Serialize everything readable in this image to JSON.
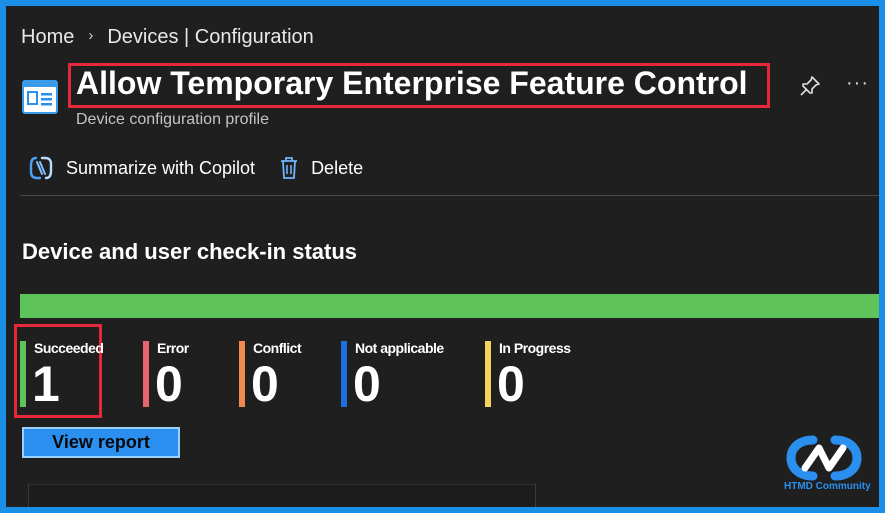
{
  "breadcrumb": {
    "home": "Home",
    "separator": "›",
    "current": "Devices | Configuration"
  },
  "header": {
    "title": "Allow Temporary Enterprise Feature Control",
    "subtitle": "Device configuration profile",
    "more_label": "···",
    "icons": [
      "profile-card-icon",
      "pin-icon",
      "more-icon"
    ]
  },
  "toolbar": {
    "copilot_label": "Summarize with Copilot",
    "delete_label": "Delete"
  },
  "section": {
    "title": "Device and user check-in status"
  },
  "status_bar": {
    "succeeded_fraction": 1.0,
    "color": "#5ec45a"
  },
  "statuses": [
    {
      "label": "Succeeded",
      "value": "1",
      "color": "#5ec45a"
    },
    {
      "label": "Error",
      "value": "0",
      "color": "#e8646e"
    },
    {
      "label": "Conflict",
      "value": "0",
      "color": "#f0894f"
    },
    {
      "label": "Not applicable",
      "value": "0",
      "color": "#1e6ee0"
    },
    {
      "label": "In Progress",
      "value": "0",
      "color": "#f4d35e"
    }
  ],
  "actions": {
    "view_report_label": "View report"
  },
  "watermark": {
    "text": "HTMD Community"
  },
  "colors": {
    "frame_border": "#1b8fe8",
    "background": "#1f1f1f",
    "highlight": "#e5283a",
    "accent": "#2b8ff0"
  }
}
